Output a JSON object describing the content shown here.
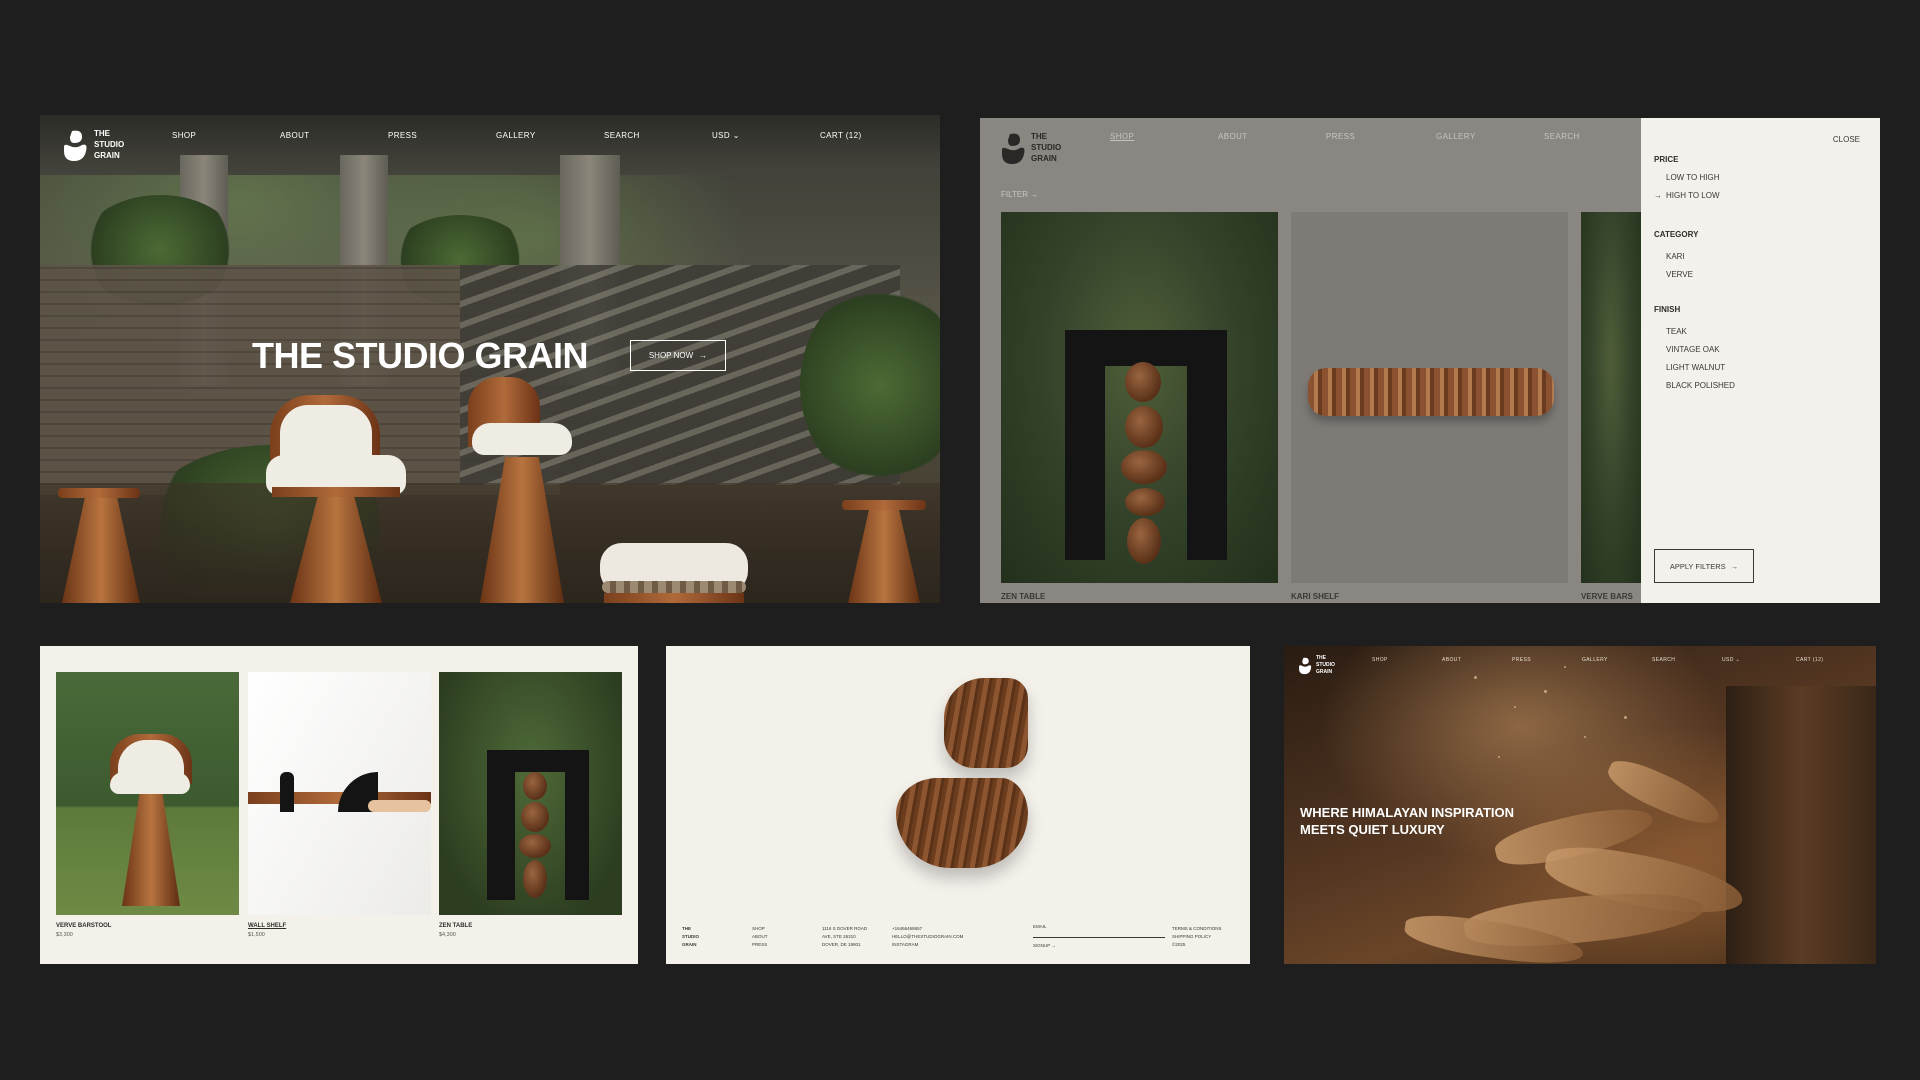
{
  "brand": {
    "line1": "THE",
    "line2": "STUDIO",
    "line3": "GRAIN"
  },
  "nav": {
    "shop": "SHOP",
    "about": "ABOUT",
    "press": "PRESS",
    "gallery": "GALLERY",
    "search": "SEARCH",
    "currency": "USD ⌄",
    "cart": "CART (12)"
  },
  "hero": {
    "title": "THE STUDIO GRAIN",
    "cta": "SHOP NOW",
    "cta_arrow": "→"
  },
  "shop": {
    "filter_link": "FILTER →",
    "products": [
      {
        "name": "ZEN TABLE"
      },
      {
        "name": "KARI SHELF"
      },
      {
        "name": "VERVE BARS"
      }
    ],
    "drawer": {
      "close": "CLOSE",
      "price_heading": "PRICE",
      "price_options": [
        "LOW TO HIGH",
        "HIGH TO LOW"
      ],
      "price_selected_marker": "→",
      "category_heading": "CATEGORY",
      "category_options": [
        "KARI",
        "VERVE"
      ],
      "finish_heading": "FINISH",
      "finish_options": [
        "TEAK",
        "VINTAGE OAK",
        "LIGHT WALNUT",
        "BLACK POLISHED"
      ],
      "apply": "APPLY FILTERS",
      "apply_arrow": "→"
    }
  },
  "products_grid": [
    {
      "name": "VERVE BARSTOOL",
      "price": "$3,300"
    },
    {
      "name": "WALL SHELF",
      "price": "$1,500"
    },
    {
      "name": "ZEN TABLE",
      "price": "$4,300"
    }
  ],
  "footer": {
    "links": [
      "SHOP",
      "ABOUT",
      "PRESS"
    ],
    "address": [
      "1116 S DOVER ROAD",
      "AVE, STE 26310",
      "DOVER, DE 19901"
    ],
    "contact": [
      "+16466468657",
      "HELLO@THESTUDIOGRAIN.COM",
      "INSTAGRAM"
    ],
    "email_label": "EMAIL",
    "signup": "SIGNUP →",
    "legal": [
      "TERMS & CONDITIONS",
      "SHIPPING POLICY",
      "©2025"
    ]
  },
  "workshop": {
    "headline": "WHERE HIMALAYAN INSPIRATION MEETS QUIET LUXURY"
  },
  "colors": {
    "background": "#1e1e1e",
    "cream": "#f4f1eb",
    "wood": "#8d5630",
    "ink": "#2f2d2a"
  }
}
